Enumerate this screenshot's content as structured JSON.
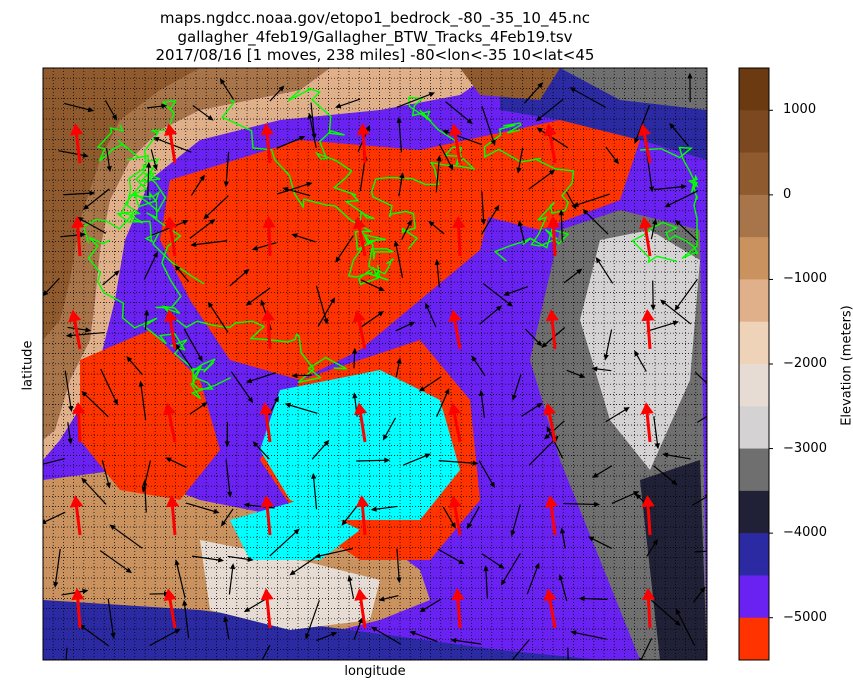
{
  "chart_data": {
    "type": "heatmap",
    "title": [
      "maps.ngdcc.noaa.gov/etopo1_bedrock_-80_-35_10_45.nc",
      "gallagher_4feb19/Gallagher_BTW_Tracks_4Feb19.tsv",
      "2017/08/16 [1 moves, 238 miles] -80<lon<-35 10<lat<45"
    ],
    "xlabel": "longitude",
    "ylabel": "latitude",
    "colorbar": {
      "label": "Elevation (meters)",
      "range": [
        -5500,
        1500
      ],
      "ticks": [
        1000,
        0,
        -1000,
        -2000,
        -3000,
        -4000,
        -5000
      ],
      "tick_labels": [
        "1000",
        "0",
        "−1000",
        "−2000",
        "−3000",
        "−4000",
        "−5000"
      ],
      "bins": [
        {
          "from": 1000,
          "to": 1500,
          "color": "#6b3a10"
        },
        {
          "from": 500,
          "to": 1000,
          "color": "#7c4820"
        },
        {
          "from": 0,
          "to": 500,
          "color": "#8e5a2e"
        },
        {
          "from": -500,
          "to": 0,
          "color": "#a8744a"
        },
        {
          "from": -1000,
          "to": -500,
          "color": "#c9925f"
        },
        {
          "from": -1500,
          "to": -1000,
          "color": "#e0b08a"
        },
        {
          "from": -2000,
          "to": -1500,
          "color": "#efd3b9"
        },
        {
          "from": -2500,
          "to": -2000,
          "color": "#e7dcd3"
        },
        {
          "from": -3000,
          "to": -2500,
          "color": "#d4d2d2"
        },
        {
          "from": -3500,
          "to": -3000,
          "color": "#6f6f6f"
        },
        {
          "from": -4000,
          "to": -3500,
          "color": "#202036"
        },
        {
          "from": -4500,
          "to": -4000,
          "color": "#2b2aa3"
        },
        {
          "from": -5000,
          "to": -4500,
          "color": "#6a22f2"
        },
        {
          "from": -5500,
          "to": -5000,
          "color": "#ff3300"
        }
      ]
    },
    "extent": {
      "lon": [
        -80,
        -35
      ],
      "lat": [
        10,
        45
      ]
    },
    "grid": true,
    "overlays": {
      "track_color": "#00ff00",
      "wind_arrow_color": "#000000",
      "current_arrow_color": "#ff0000",
      "deep_basin_color": "#00ffff"
    }
  }
}
